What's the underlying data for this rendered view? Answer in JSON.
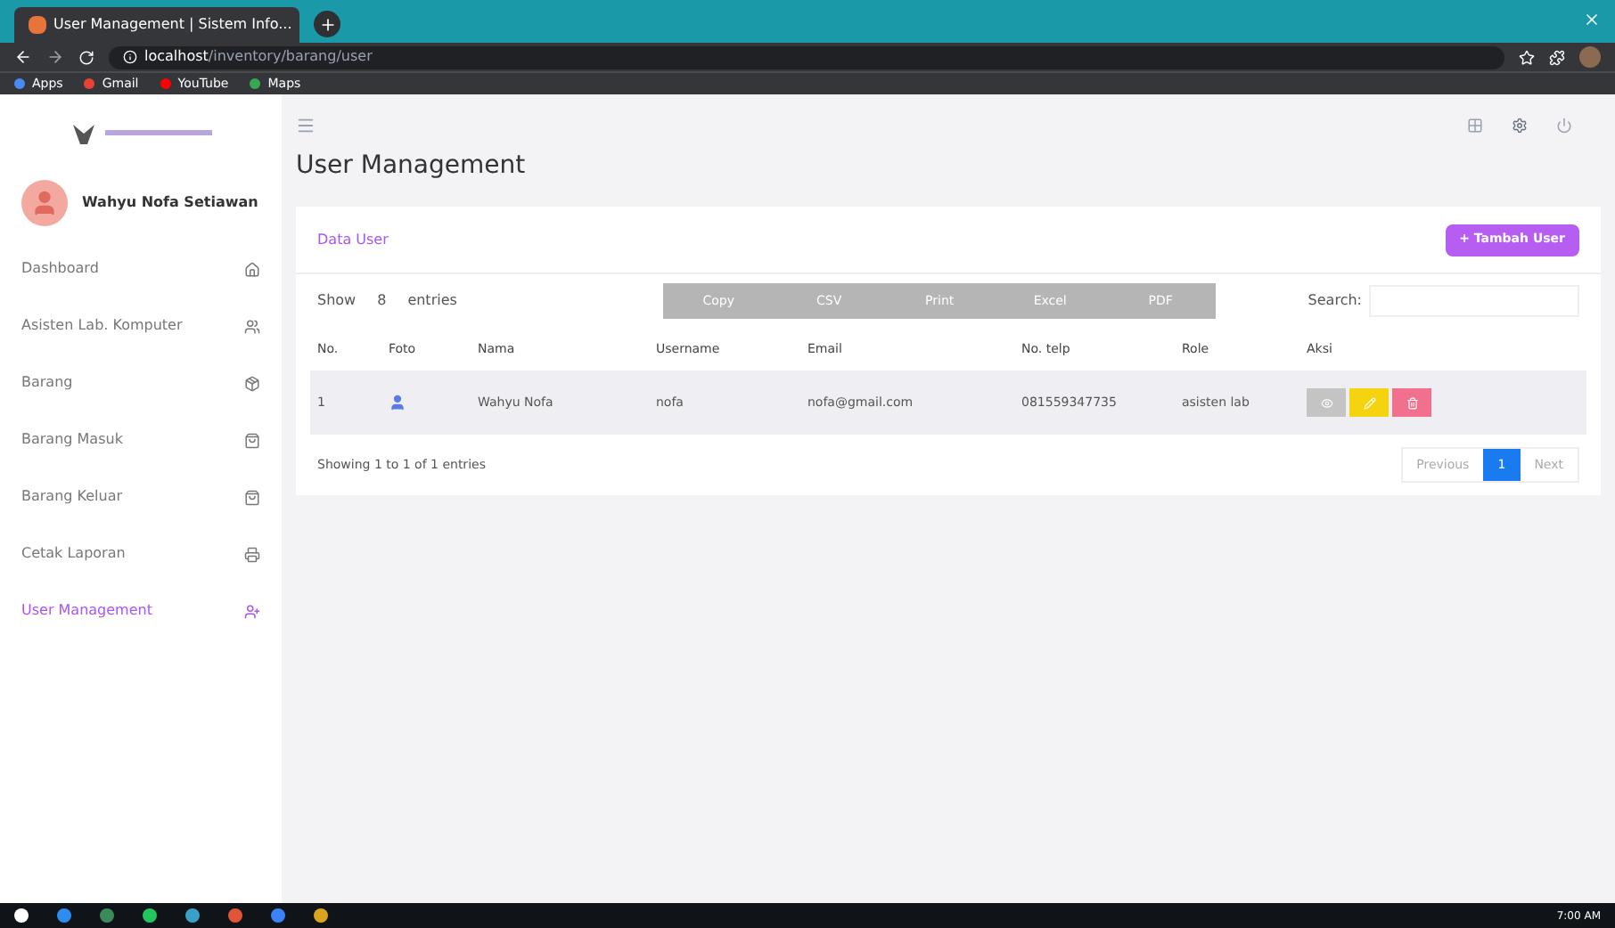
{
  "browser": {
    "tab_title": "User Management | Sistem Info...",
    "url_host": "localhost",
    "url_path": "/inventory/barang/user",
    "bookmarks": [
      "Apps",
      "Gmail",
      "YouTube",
      "Maps"
    ]
  },
  "sidebar": {
    "user_name": "Wahyu Nofa Setiawan",
    "menu": [
      {
        "label": "Dashboard",
        "selected": false
      },
      {
        "label": "Asisten Lab. Komputer",
        "selected": false
      },
      {
        "label": "Barang",
        "selected": false
      },
      {
        "label": "Barang Masuk",
        "selected": false
      },
      {
        "label": "Barang Keluar",
        "selected": false
      },
      {
        "label": "Cetak Laporan",
        "selected": false
      },
      {
        "label": "User Management",
        "selected": true
      }
    ]
  },
  "page_title": "User Management",
  "card": {
    "title": "Data User",
    "add_button": "+ Tambah User",
    "show_label": "Show",
    "page_size": "8",
    "entries_label": "entries",
    "export_buttons": [
      "Copy",
      "CSV",
      "Print",
      "Excel",
      "PDF"
    ],
    "search_label": "Search:",
    "columns": [
      "No.",
      "Foto",
      "Nama",
      "Username",
      "Email",
      "No. telp",
      "Role",
      "Aksi"
    ],
    "rows": [
      {
        "no": "1",
        "nama": "Wahyu Nofa",
        "username": "nofa",
        "email": "nofa@gmail.com",
        "telp": "081559347735",
        "role": "asisten lab"
      }
    ],
    "info": "Showing 1 to 1 of 1 entries",
    "pagination": [
      {
        "label": "Previous",
        "selected": false
      },
      {
        "label": "1",
        "selected": true
      },
      {
        "label": "Next",
        "selected": false
      }
    ]
  },
  "taskbar": {
    "time": "7:00 AM"
  }
}
